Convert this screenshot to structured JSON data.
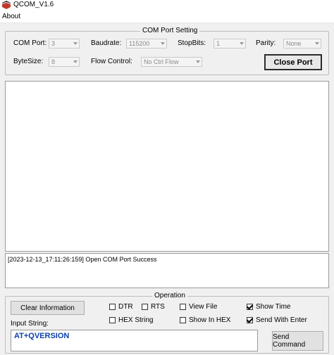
{
  "window": {
    "title": "QCOM_V1.6"
  },
  "menu": {
    "about": "About"
  },
  "com_setting": {
    "group_title": "COM Port Setting",
    "com_port_label": "COM Port:",
    "com_port_value": "3",
    "baudrate_label": "Baudrate:",
    "baudrate_value": "115200",
    "stopbits_label": "StopBits:",
    "stopbits_value": "1",
    "parity_label": "Parity:",
    "parity_value": "None",
    "bytesize_label": "ByteSize:",
    "bytesize_value": "8",
    "flow_control_label": "Flow Control:",
    "flow_control_value": "No Ctrl Flow",
    "close_port_label": "Close Port"
  },
  "log": {
    "line": "[2023-12-13_17:11:26:159] Open COM Port Success"
  },
  "operation": {
    "group_title": "Operation",
    "clear_label": "Clear Information",
    "input_label": "Input String:",
    "input_value": "AT+QVERSION",
    "send_label": "Send Command",
    "checkboxes": {
      "dtr": {
        "label": "DTR",
        "checked": false
      },
      "rts": {
        "label": "RTS",
        "checked": false
      },
      "view_file": {
        "label": "View File",
        "checked": false
      },
      "show_time": {
        "label": "Show Time",
        "checked": true
      },
      "hex_string": {
        "label": "HEX String",
        "checked": false
      },
      "show_in_hex": {
        "label": "Show In HEX",
        "checked": false
      },
      "send_with_enter": {
        "label": "Send With Enter",
        "checked": true
      }
    }
  },
  "colors": {
    "input_text": "#0b3fa8",
    "background": "#f0f0f0",
    "app_icon": "#c0392b"
  }
}
